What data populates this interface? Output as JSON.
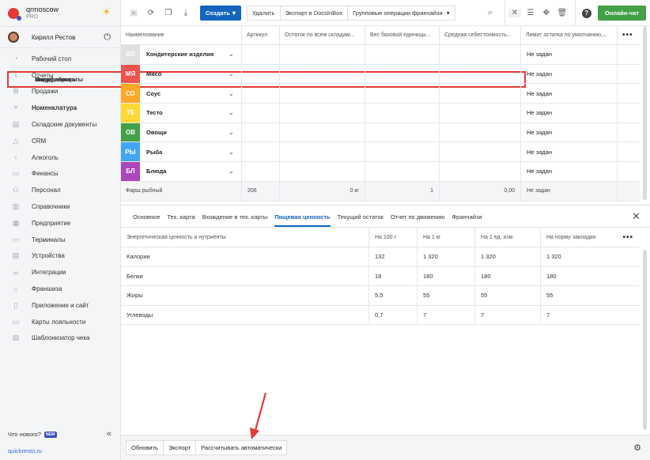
{
  "app": {
    "name": "qrmoscow",
    "plan": "PRO"
  },
  "user": {
    "name": "Кирилл Рестов"
  },
  "sidebar": {
    "items": [
      {
        "label": "Рабочий стол",
        "icon": "gauge-icon",
        "type": "main"
      },
      {
        "label": "Отчеты",
        "icon": "chart-icon",
        "type": "main"
      },
      {
        "label": "Продажи",
        "icon": "cart-icon",
        "type": "main"
      },
      {
        "label": "Номенклатура",
        "icon": "tag-icon",
        "type": "main-bold"
      },
      {
        "label": "Блюда",
        "type": "sub"
      },
      {
        "label": "Модификаторы",
        "type": "sub"
      },
      {
        "label": "Ингредиенты",
        "type": "sub"
      },
      {
        "label": "Полуфабрикаты",
        "type": "sub-active"
      },
      {
        "label": "Меню",
        "type": "sub"
      },
      {
        "label": "Складские документы",
        "icon": "document-icon",
        "type": "main"
      },
      {
        "label": "CRM",
        "icon": "triangle-icon",
        "type": "main"
      },
      {
        "label": "Алкоголь",
        "icon": "glass-icon",
        "type": "main"
      },
      {
        "label": "Финансы",
        "icon": "wallet-icon",
        "type": "main"
      },
      {
        "label": "Персонал",
        "icon": "people-icon",
        "type": "main"
      },
      {
        "label": "Справочники",
        "icon": "book-icon",
        "type": "main"
      },
      {
        "label": "Предприятие",
        "icon": "building-icon",
        "type": "main"
      },
      {
        "label": "Терминалы",
        "icon": "monitor-icon",
        "type": "main"
      },
      {
        "label": "Устройства",
        "icon": "printer-icon",
        "type": "main"
      },
      {
        "label": "Интеграции",
        "icon": "link-icon",
        "type": "main"
      },
      {
        "label": "Франшиза",
        "icon": "franchise-icon",
        "type": "main"
      },
      {
        "label": "Приложение и сайт",
        "icon": "phone-icon",
        "type": "main"
      },
      {
        "label": "Карты лояльности",
        "icon": "card-icon",
        "type": "main"
      },
      {
        "label": "Шаблонизатор чека",
        "icon": "receipt-icon",
        "type": "main"
      }
    ],
    "whats_new": "Что нового?",
    "new_badge": "NEW",
    "site": "quickresto.ru"
  },
  "toolbar": {
    "create": "Создать",
    "delete": "Удалить",
    "export": "Экспорт в DocsInBox",
    "group_ops": "Групповые операции франчайзи",
    "online_chat": "Онлайн-чат"
  },
  "table": {
    "headers": [
      "Наименование",
      "Артикул",
      "Остаток по всем складам...",
      "Вес базовой единицы...",
      "Средняя себестоимость...",
      "Лимит остатка по умолчанию,..."
    ],
    "categories": [
      {
        "code": "КО",
        "name": "Кондитерские изделия",
        "color": "#e0e0e0",
        "limit": "Не задан"
      },
      {
        "code": "МЯ",
        "name": "Мясо",
        "color": "#ef5350",
        "limit": "Не задан"
      },
      {
        "code": "СО",
        "name": "Соус",
        "color": "#ffa726",
        "limit": "Не задан"
      },
      {
        "code": "ТЕ",
        "name": "Тесто",
        "color": "#fdd835",
        "limit": "Не задан"
      },
      {
        "code": "ОВ",
        "name": "Овощи",
        "color": "#43a047",
        "limit": "Не задан"
      },
      {
        "code": "РЫ",
        "name": "Рыба",
        "color": "#42a5f5",
        "limit": "Не задан"
      },
      {
        "code": "БЛ",
        "name": "Блюда",
        "color": "#ab47bc",
        "limit": "Не задан"
      }
    ],
    "item": {
      "name": "Фарш рыбный",
      "article": "206",
      "stock": "0 кг",
      "weight": "1",
      "cost": "0,00",
      "limit": "Не задан"
    }
  },
  "tabs": [
    "Основное",
    "Тех. карта",
    "Вхождение в тех. карты",
    "Пищевая ценность",
    "Текущий остаток",
    "Отчет по движению",
    "Франчайзи"
  ],
  "active_tab": "Пищевая ценность",
  "nutrition": {
    "headers": [
      "Энергетическая ценность и нутриенты",
      "На 100 г",
      "На 1 кг",
      "На 1 ед. изм.",
      "На норму закладки"
    ],
    "rows": [
      [
        "Калории",
        "132",
        "1 320",
        "1 320",
        "1 320"
      ],
      [
        "Белки",
        "18",
        "180",
        "180",
        "180"
      ],
      [
        "Жиры",
        "5,5",
        "55",
        "55",
        "55"
      ],
      [
        "Углеводы",
        "0,7",
        "7",
        "7",
        "7"
      ]
    ]
  },
  "bottom": {
    "refresh": "Обновить",
    "export": "Экспорт",
    "auto": "Рассчитывать автоматически"
  },
  "colors": {
    "accent": "#1565c0",
    "online": "#43a047",
    "highlight": "#e53935"
  }
}
